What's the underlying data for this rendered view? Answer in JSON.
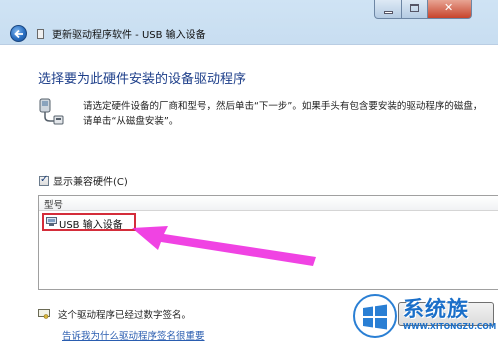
{
  "window": {
    "title": "更新驱动程序软件 - USB 输入设备"
  },
  "page": {
    "heading": "选择要为此硬件安装的设备驱动程序",
    "instructions": "请选定硬件设备的厂商和型号，然后单击“下一步”。如果手头有包含要安装的驱动程序的磁盘，请单击“从磁盘安装”。",
    "show_compatible_label": "显示兼容硬件(C)",
    "show_compatible_checked": true,
    "list": {
      "column_header": "型号",
      "items": [
        {
          "label": "USB 输入设备",
          "highlighted": true
        }
      ]
    },
    "signed_text": "这个驱动程序已经过数字签名。",
    "signing_link": "告诉我为什么驱动程序签名很重要"
  },
  "watermark": {
    "text": "系统族",
    "url": "WWW.XITONGZU.COM"
  },
  "colors": {
    "heading": "#1e3f8a",
    "link": "#2a5db0",
    "highlight_box": "#d42d3a",
    "arrow": "#ee2fe0",
    "watermark": "#1a6fc9"
  },
  "icons": {
    "back": "back-arrow-icon",
    "hardware": "hardware-install-icon",
    "device": "usb-device-icon",
    "signature": "signed-driver-icon"
  }
}
